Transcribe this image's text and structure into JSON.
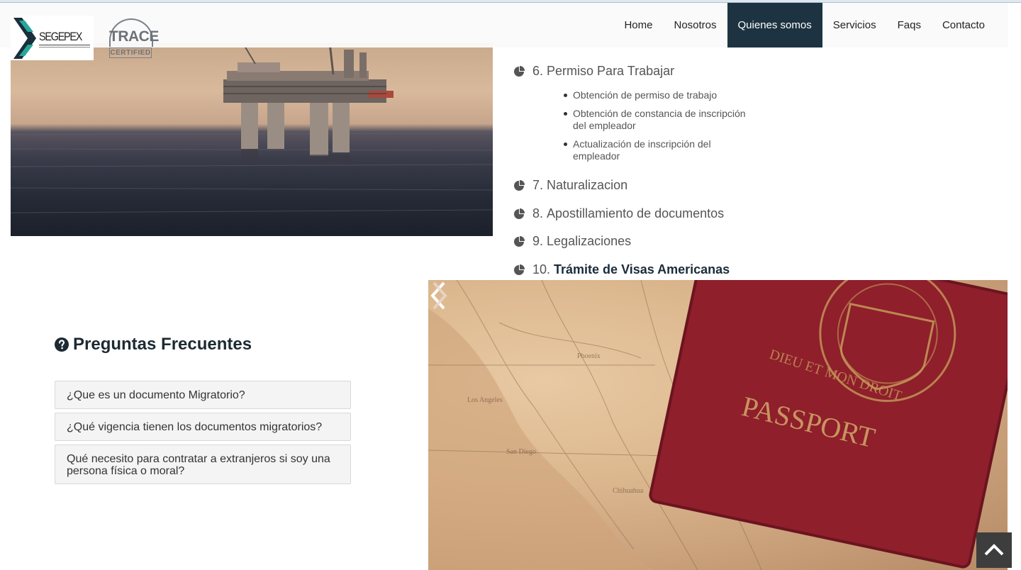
{
  "brand": {
    "logo_text": "SEGEPEX",
    "trace_word": "TRACE",
    "trace_cert": "CERTIFIED"
  },
  "nav": {
    "items": [
      "Home",
      "Nosotros",
      "Quienes somos",
      "Servicios",
      "Faqs",
      "Contacto"
    ],
    "active": "Quienes somos"
  },
  "services": {
    "items": [
      {
        "number": "6.",
        "label": "Permiso Para Trabajar"
      },
      {
        "number": "7.",
        "label": "Naturalizacion"
      },
      {
        "number": "8.",
        "label": "Apostillamiento de documentos"
      },
      {
        "number": "9.",
        "label": "Legalizaciones"
      },
      {
        "number": "10.",
        "label": "Trámite de Visas Americanas"
      }
    ],
    "sub_items": [
      "Obtención de permiso de trabajo",
      "Obtención de constancia de inscripción del empleador",
      "Actualización de inscripción del empleador"
    ]
  },
  "faq": {
    "title": "Preguntas Frecuentes",
    "questions": [
      "¿Que es un documento Migratorio?",
      "¿Qué vigencia tienen los documentos migratorios?",
      "Qué necesito para contratar a extranjeros si soy una persona física o moral?"
    ]
  },
  "images": {
    "passport_text": "PASSPORT",
    "passport_motto": "DIEU ET MON DROIT"
  },
  "colors": {
    "nav_active_bg": "#1d3341",
    "heading": "#1d2a33",
    "passport_red": "#8e1f2b",
    "to_top_bg": "#3d3d3d"
  },
  "icons": {
    "faq_heading": "question-circle-icon",
    "service_bullet": "pie-chart-icon",
    "carousel_prev": "chevron-left-icon",
    "carousel_next": "chevron-right-icon",
    "back_to_top": "chevron-up-icon"
  }
}
